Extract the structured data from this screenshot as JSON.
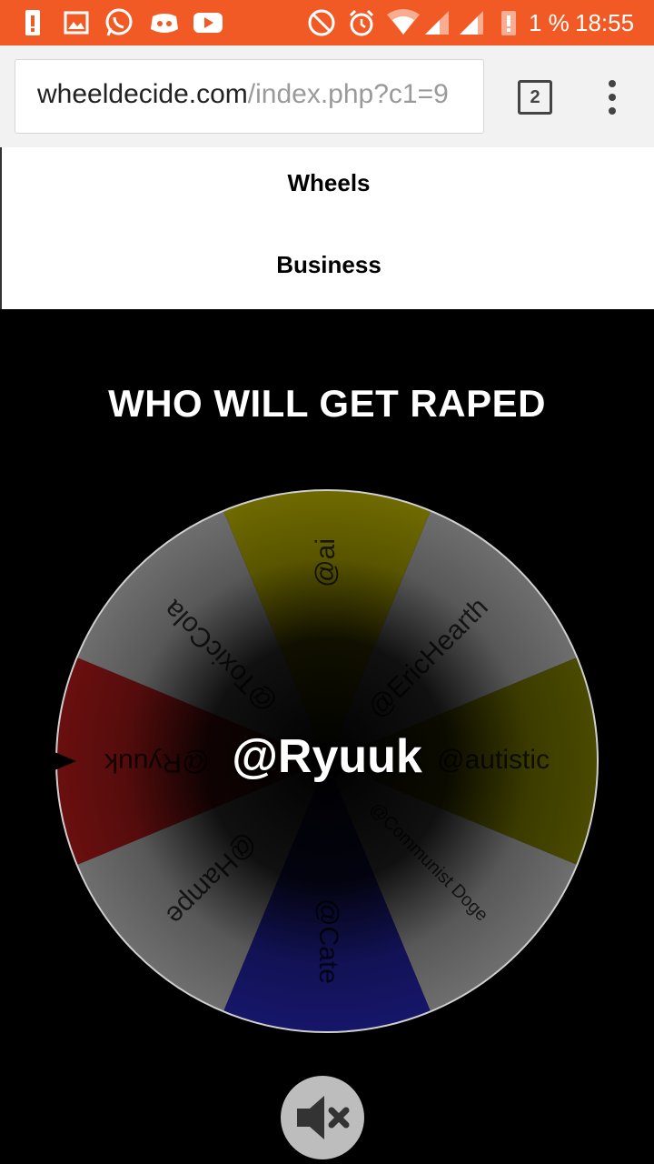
{
  "statusbar": {
    "battery_percent": "1 %",
    "time": "18:55"
  },
  "browser": {
    "url_domain": "wheeldecide.com",
    "url_path": "/index.php?c1=9",
    "tab_count": "2"
  },
  "nav": {
    "items": [
      "Wheels",
      "Business"
    ]
  },
  "page": {
    "title": "WHO WILL GET RAPED",
    "result": "@Ryuuk"
  },
  "wheel": {
    "segments": [
      {
        "label": "@ai",
        "color": "#6f6a00"
      },
      {
        "label": "@EricHearth",
        "color": "#6e6e6e"
      },
      {
        "label": "@autistic",
        "color": "#4a4a00"
      },
      {
        "label": "@Communist Doge",
        "color": "#6e6e6e"
      },
      {
        "label": "@Cate",
        "color": "#16166a"
      },
      {
        "label": "@Hampe",
        "color": "#6e6e6e"
      },
      {
        "label": "@Ryuuk",
        "color": "#6a0f0f"
      },
      {
        "label": "@ToxicCola",
        "color": "#6e6e6e"
      }
    ]
  }
}
